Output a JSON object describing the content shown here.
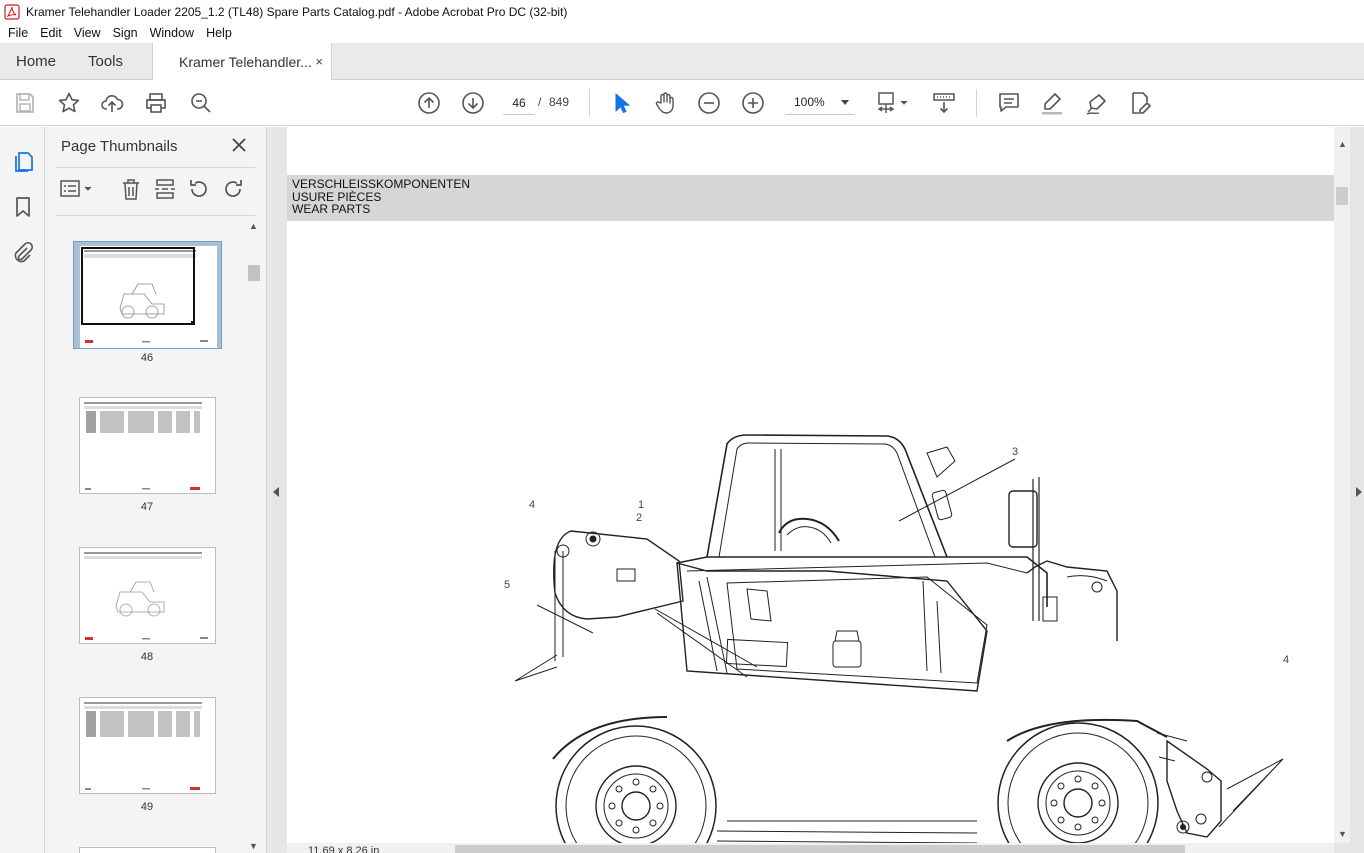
{
  "window": {
    "title": "Kramer Telehandler Loader 2205_1.2 (TL48) Spare Parts Catalog.pdf - Adobe Acrobat Pro DC (32-bit)"
  },
  "menu": [
    "File",
    "Edit",
    "View",
    "Sign",
    "Window",
    "Help"
  ],
  "tabs": {
    "home": "Home",
    "tools": "Tools",
    "document": "Kramer Telehandler...",
    "close": "×"
  },
  "toolbar": {
    "current_page": "46",
    "page_separator": "/",
    "total_pages": "849",
    "zoom": "100%"
  },
  "thumbnails": {
    "title": "Page Thumbnails",
    "pages": [
      {
        "label": "46",
        "selected": true
      },
      {
        "label": "47",
        "selected": false
      },
      {
        "label": "48",
        "selected": false
      },
      {
        "label": "49",
        "selected": false
      }
    ]
  },
  "document": {
    "header_lines": [
      "VERSCHLEISSKOMPONENTEN",
      "USURE PIÈCES",
      "WEAR PARTS"
    ],
    "callouts": [
      "1",
      "2",
      "3",
      "4",
      "4",
      "5"
    ],
    "page_size": "11,69 x 8,26 in"
  },
  "colors": {
    "selection": "#a7bfd7",
    "acrobat_red": "#d7191c",
    "header_band": "#d6d6d6"
  }
}
